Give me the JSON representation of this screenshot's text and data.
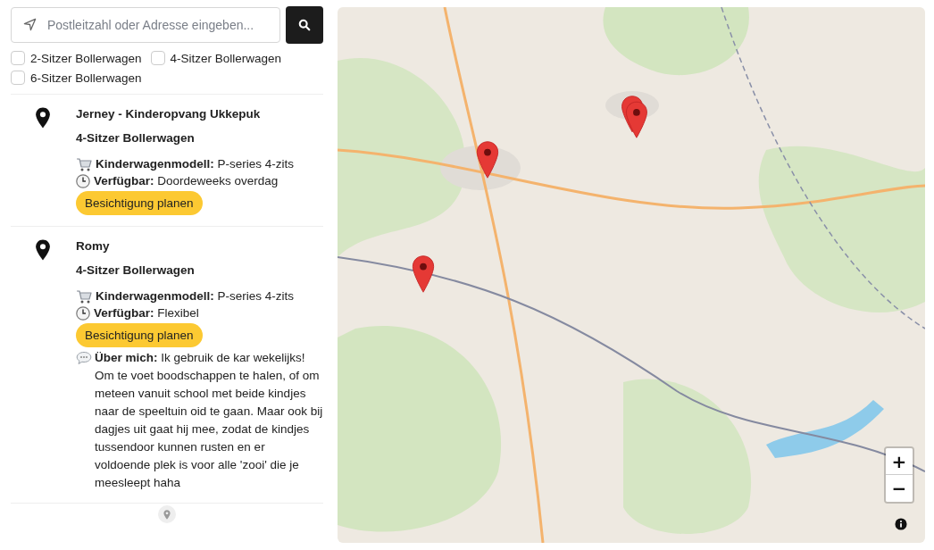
{
  "search": {
    "placeholder": "Postleitzahl oder Adresse eingeben..."
  },
  "filters": [
    {
      "label": "2-Sitzer Bollerwagen",
      "checked": false
    },
    {
      "label": "4-Sitzer Bollerwagen",
      "checked": false
    },
    {
      "label": "6-Sitzer Bollerwagen",
      "checked": false
    }
  ],
  "listings": [
    {
      "name": "Jerney - Kinderopvang Ukkepuk",
      "type": "4-Sitzer Bollerwagen",
      "model": "**Kinderwagenmodell:** P-series 4-zits",
      "availability": "**Verfügbar:** Doordeweeks overdag",
      "button": "Besichtigung planen"
    },
    {
      "name": "Romy",
      "type": "4-Sitzer Bollerwagen",
      "model": "**Kinderwagenmodell:** P-series 4-zits",
      "availability": "**Verfügbar:** Flexibel",
      "button": "Besichtigung planen",
      "about": "**Über mich:** Ik gebruik de kar wekelijks! Om te voet boodschappen te halen, of om meteen vanuit school met beide kindjes naar de speeltuin oid te gaan. Maar ook bij dagjes uit gaat hij mee, zodat de kindjes tussendoor kunnen rusten en er voldoende plek is voor alle 'zooi' die je meesleept haha"
    }
  ],
  "map": {
    "zoom_in": "+",
    "zoom_out": "−"
  }
}
